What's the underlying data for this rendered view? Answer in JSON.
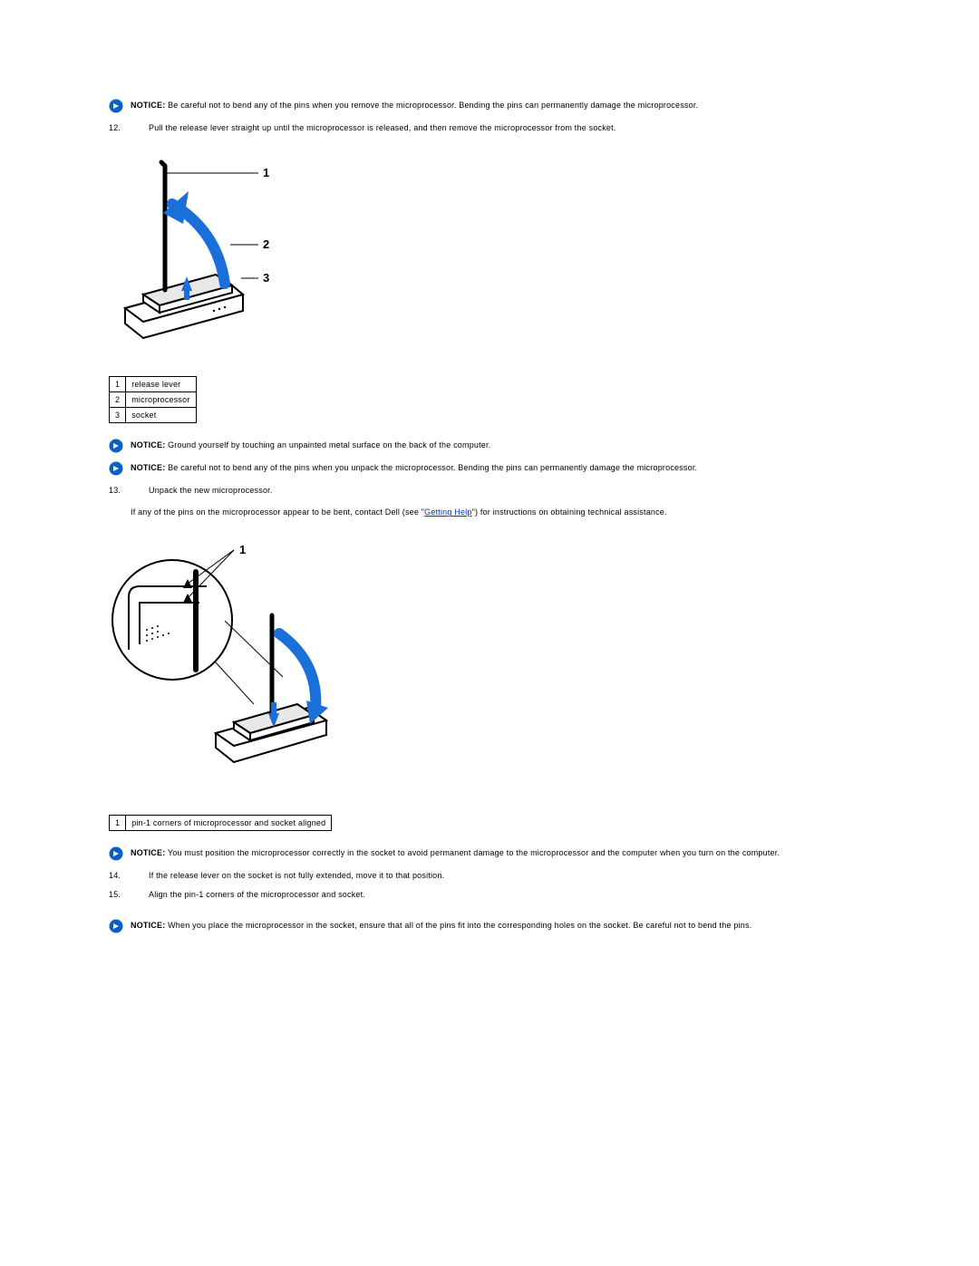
{
  "notices": {
    "n1_label": "NOTICE:",
    "n1_text": " Be careful not to bend any of the pins when you remove the microprocessor. Bending the pins can permanently damage the microprocessor.",
    "n2_label": "NOTICE:",
    "n2_text": " Ground yourself by touching an unpainted metal surface on the back of the computer.",
    "n3_label": "NOTICE:",
    "n3_text": " Be careful not to bend any of the pins when you unpack the microprocessor. Bending the pins can permanently damage the microprocessor.",
    "n4_label": "NOTICE:",
    "n4_text": " You must position the microprocessor correctly in the socket to avoid permanent damage to the microprocessor and the computer when you turn on the computer.",
    "n5_label": "NOTICE:",
    "n5_text": " When you place the microprocessor in the socket, ensure that all of the pins fit into the corresponding holes on the socket. Be careful not to bend the pins."
  },
  "steps": {
    "s12_num": "12.",
    "s12_text": "Pull the release lever straight up until the microprocessor is released, and then remove the microprocessor from the socket.",
    "s13_num": "13.",
    "s13_text": "Unpack the new microprocessor.",
    "s13_sub_pre": "If any of the pins on the microprocessor appear to be bent, contact Dell (see \"",
    "s13_link": "Getting Help",
    "s13_sub_post": "\") for instructions on obtaining technical assistance.",
    "s14_num": "14.",
    "s14_text": "If the release lever on the socket is not fully extended, move it to that position.",
    "s15_num": "15.",
    "s15_text": "Align the pin-1 corners of the microprocessor and socket."
  },
  "table1": {
    "r1n": "1",
    "r1t": "release lever",
    "r2n": "2",
    "r2t": "microprocessor",
    "r3n": "3",
    "r3t": "socket"
  },
  "table2": {
    "r1n": "1",
    "r1t": "pin-1 corners of microprocessor and socket aligned"
  },
  "fig1": {
    "l1": "1",
    "l2": "2",
    "l3": "3"
  },
  "fig2": {
    "l1": "1"
  }
}
